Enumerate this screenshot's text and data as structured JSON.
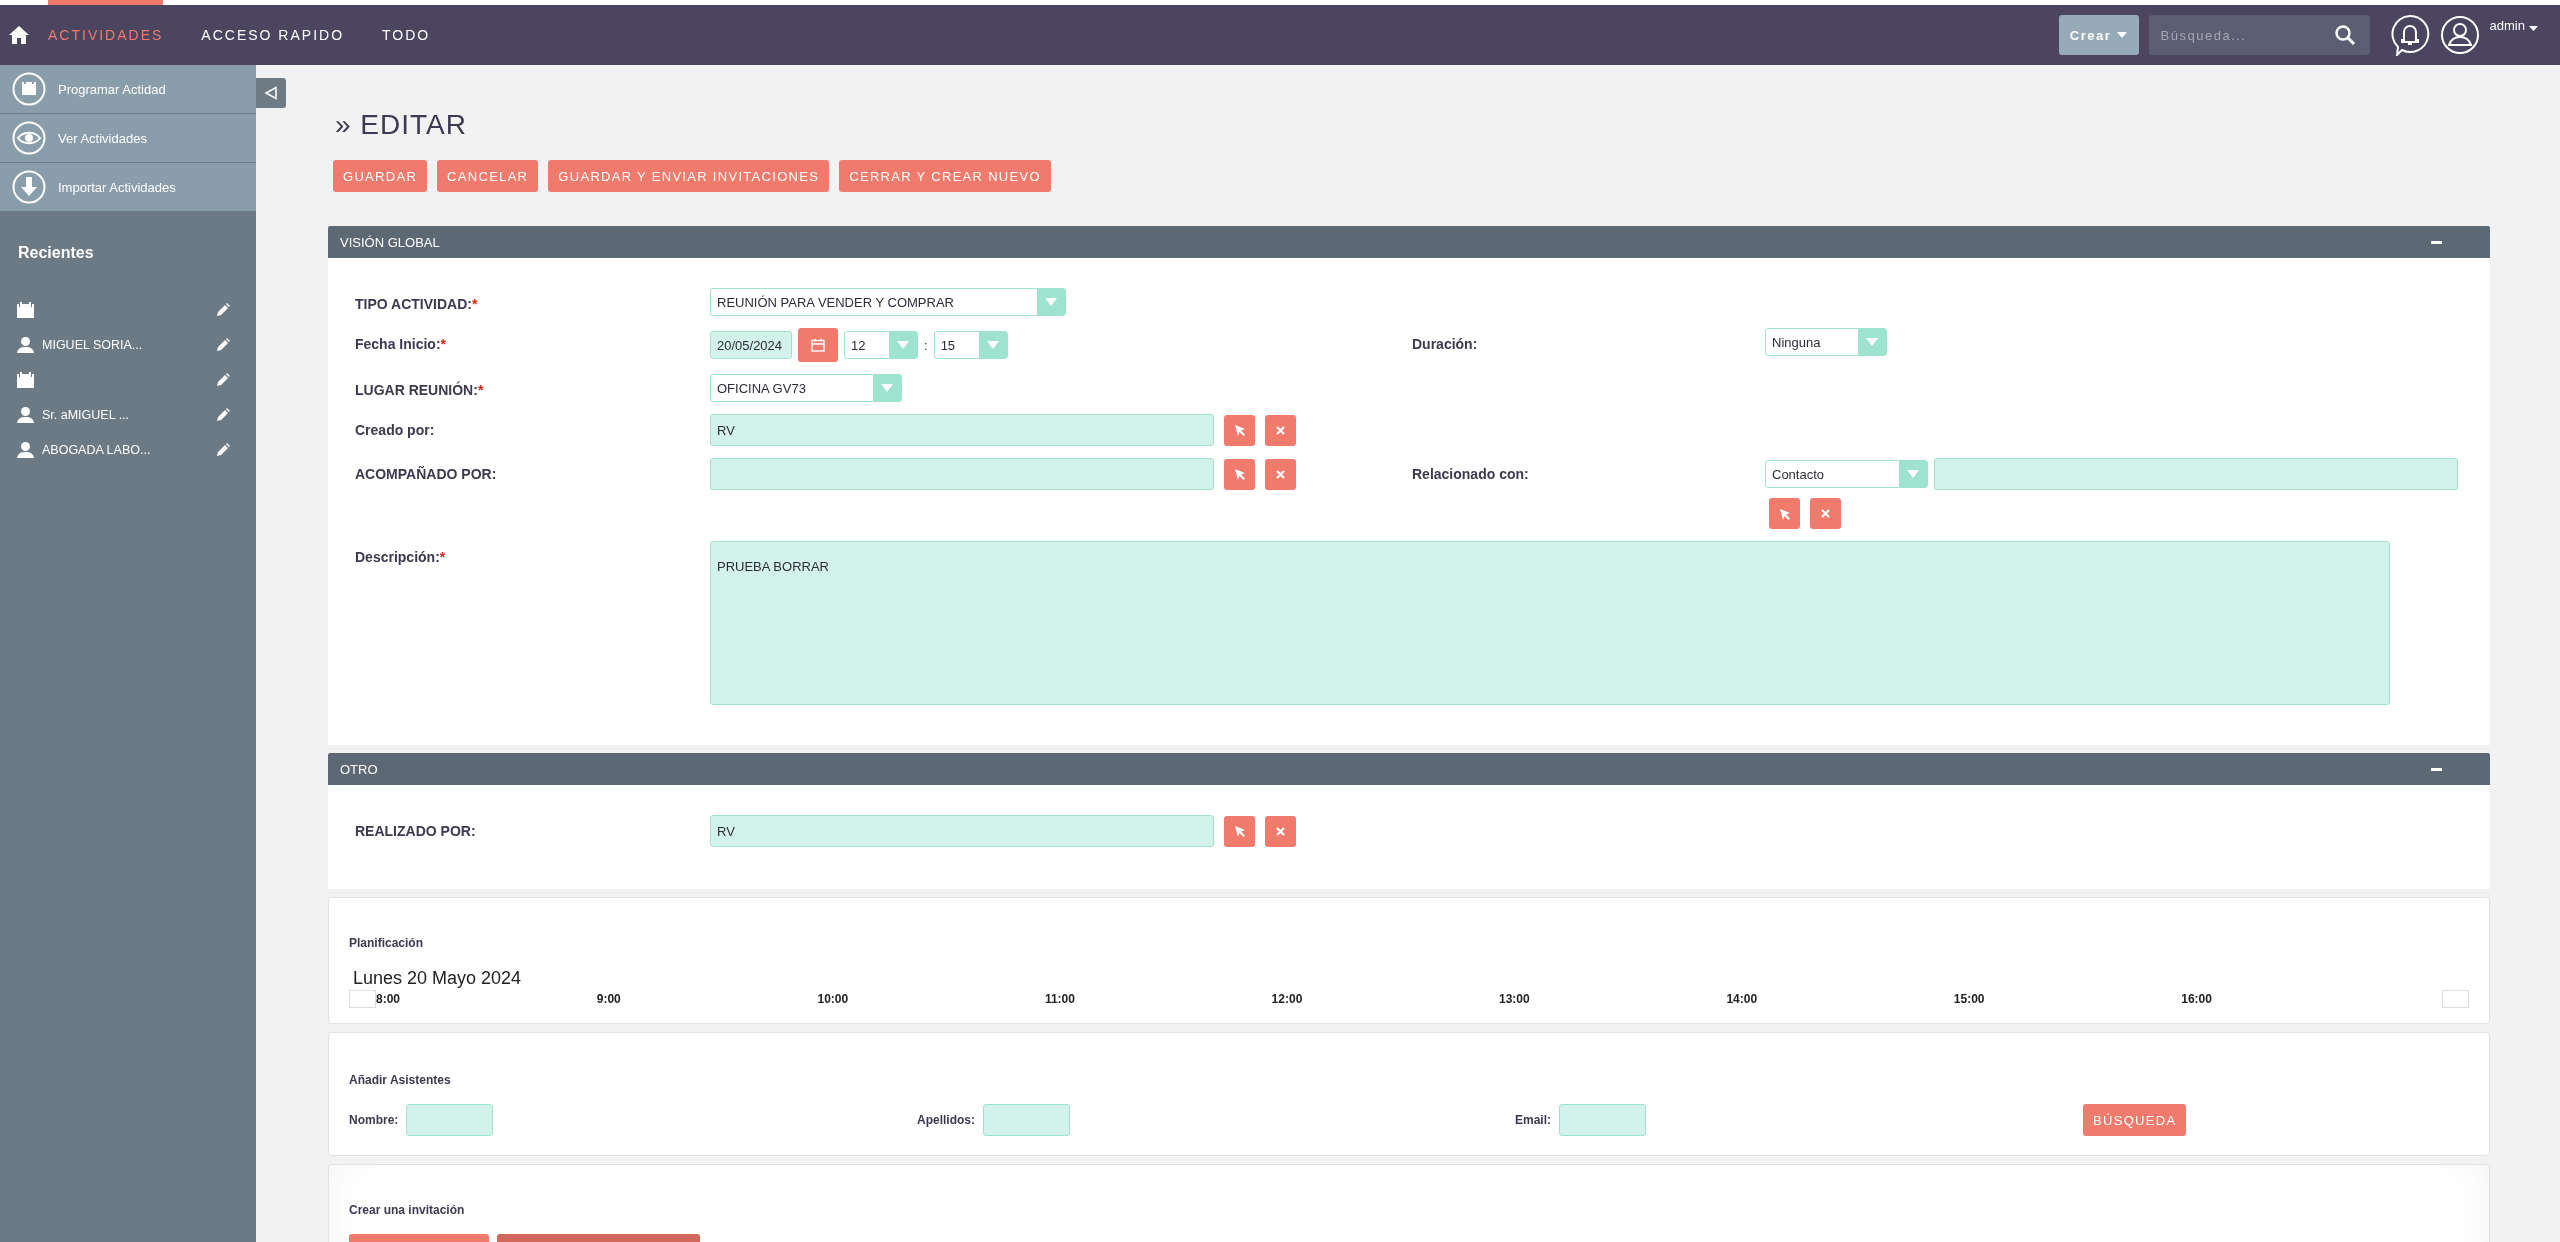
{
  "top_nav": {
    "tabs": [
      {
        "label": "ACTIVIDADES",
        "selected": true
      },
      {
        "label": "ACCESO RAPIDO",
        "selected": false
      },
      {
        "label": "TODO",
        "selected": false
      }
    ],
    "create_button": "Crear",
    "search": {
      "placeholder": "Búsqueda..."
    },
    "user": "admin"
  },
  "sidebar": {
    "actions": [
      {
        "kind": "calendar",
        "label": "Programar Actidad"
      },
      {
        "kind": "view",
        "label": "Ver Actividades"
      },
      {
        "kind": "import",
        "label": "Importar Actividades"
      }
    ],
    "recent_title": "Recientes",
    "recent": [
      {
        "kind": "activity"
      },
      {
        "kind": "person",
        "label": "MIGUEL SORIA..."
      },
      {
        "kind": "activity"
      },
      {
        "kind": "person",
        "label": "Sr. aMIGUEL ..."
      },
      {
        "kind": "person",
        "label": "ABOGADA LABO..."
      }
    ]
  },
  "page_title": "» EDITAR",
  "action_buttons": [
    "GUARDAR",
    "CANCELAR",
    "GUARDAR Y ENVIAR INVITACIONES",
    "CERRAR Y CREAR NUEVO"
  ],
  "overview": {
    "title": "VISIÓN GLOBAL",
    "expanded": true,
    "tipo_actividad": {
      "label": "TIPO ACTIVIDAD:",
      "required_mark": "*",
      "value": "REUNIÓN PARA VENDER Y COMPRAR"
    },
    "fecha_inicio": {
      "label": "Fecha Inicio:",
      "required_mark": "*",
      "date": "20/05/2024",
      "hour": "12",
      "separator": ":",
      "minute": "15"
    },
    "duracion": {
      "label": "Duración:",
      "value": "Ninguna"
    },
    "lugar_reunion": {
      "label": "LUGAR REUNIÓN:",
      "required_mark": "*",
      "value": "OFICINA GV73"
    },
    "creado_por": {
      "label": "Creado por:",
      "value": "RV"
    },
    "acompanado_por": {
      "label": "ACOMPAÑADO POR:"
    },
    "relacionado_con": {
      "label": "Relacionado con:",
      "type": "Contacto"
    },
    "descripcion": {
      "label": "Descripción:",
      "required_mark": "*",
      "value": "PRUEBA BORRAR"
    }
  },
  "other": {
    "title": "OTRO",
    "expanded": true,
    "realizado_por": {
      "label": "REALIZADO POR:",
      "value": "RV"
    }
  },
  "planning": {
    "title": "Planificación",
    "date": "Lunes 20 Mayo 2024",
    "hours": [
      "8:00",
      "9:00",
      "10:00",
      "11:00",
      "12:00",
      "13:00",
      "14:00",
      "15:00",
      "16:00"
    ]
  },
  "attendees": {
    "title": "Añadir Asistentes",
    "fields": [
      {
        "label": "Nombre:"
      },
      {
        "label": "Apellidos:"
      },
      {
        "label": "Email:"
      }
    ],
    "search_button": "BÚSQUEDA"
  },
  "invitation": {
    "title": "Crear una invitación"
  }
}
